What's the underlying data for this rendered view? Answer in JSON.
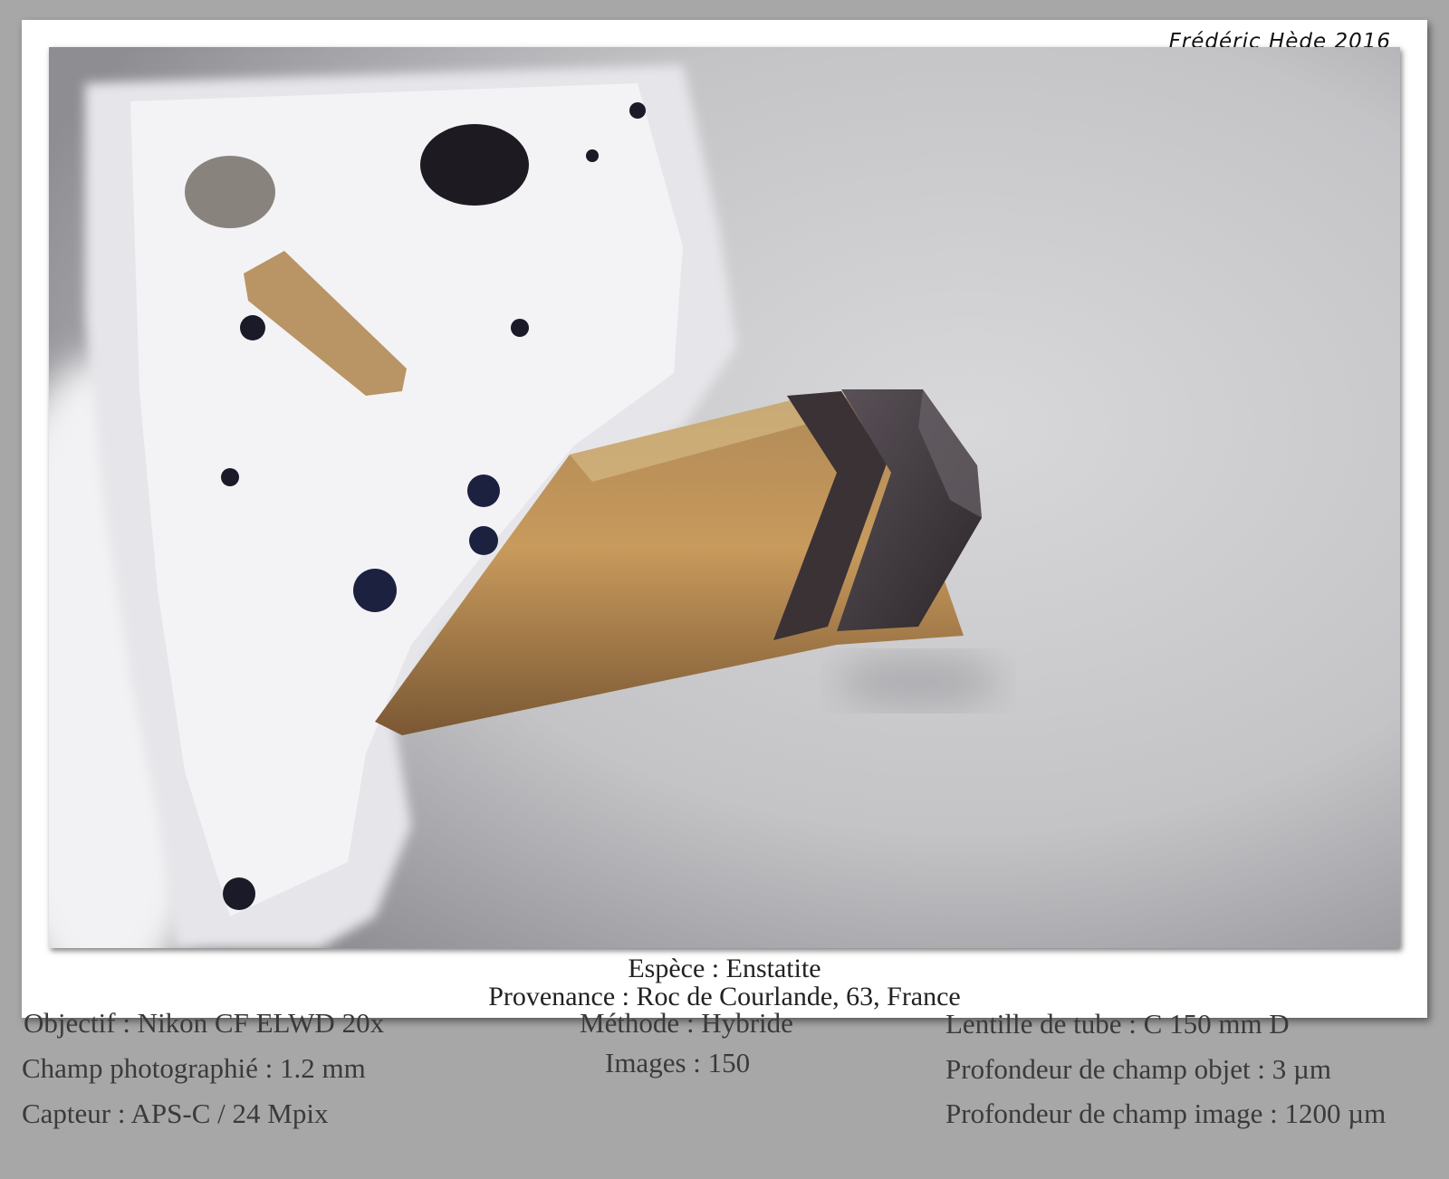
{
  "signature": "Frédéric Hède 2016",
  "caption": {
    "species": "Espèce : Enstatite",
    "provenance": "Provenance : Roc de Courlande, 63, France"
  },
  "details": {
    "objective": "Objectif : Nikon CF ELWD 20x",
    "field": "Champ photographié : 1.2 mm",
    "sensor": "Capteur : APS-C / 24 Mpix",
    "method": "Méthode : Hybride",
    "images": "Images : 150",
    "tube_lens": "Lentille de tube : C 150 mm D",
    "object_dof": "Profondeur de champ objet : 3 µm",
    "image_dof": "Profondeur de champ image : 1200 µm"
  }
}
